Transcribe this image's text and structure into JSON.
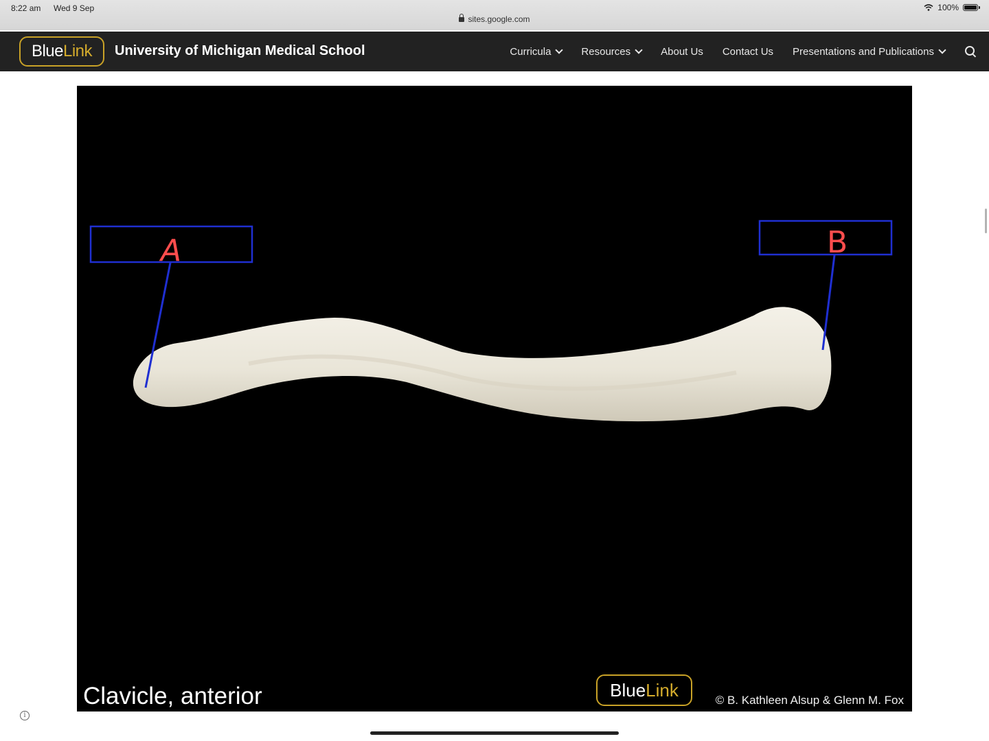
{
  "status_bar": {
    "time": "8:22 am",
    "date": "Wed 9 Sep",
    "url": "sites.google.com",
    "battery": "100%"
  },
  "header": {
    "logo": {
      "part1": "Blue",
      "part2": "Link"
    },
    "site_name": "University of Michigan Medical School",
    "nav": [
      {
        "label": "Curricula",
        "has_dropdown": true
      },
      {
        "label": "Resources",
        "has_dropdown": true
      },
      {
        "label": "About Us",
        "has_dropdown": false
      },
      {
        "label": "Contact Us",
        "has_dropdown": false
      },
      {
        "label": "Presentations and Publications",
        "has_dropdown": true
      }
    ]
  },
  "image": {
    "caption": "Clavicle, anterior",
    "label_a": "A",
    "label_b": "B",
    "watermark": {
      "part1": "Blue",
      "part2": "Link"
    },
    "copyright": "© B. Kathleen Alsup & Glenn M. Fox"
  },
  "colors": {
    "header_bg": "#222222",
    "logo_gold": "#c9a227",
    "annotation_blue": "#1f2fd1",
    "annotation_red": "#ff4d4d",
    "bone": "#ece8dc"
  }
}
